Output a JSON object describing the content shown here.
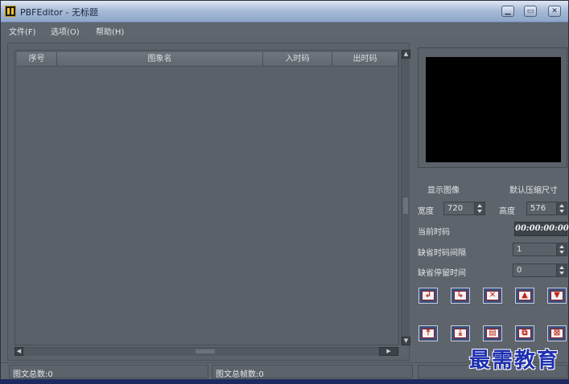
{
  "window": {
    "title": "PBFEditor - 无标题"
  },
  "menu": [
    "文件(F)",
    "选项(O)",
    "帮助(H)"
  ],
  "list": {
    "columns": [
      "序号",
      "图象名",
      "入时码",
      "出时码"
    ]
  },
  "preview": {
    "display_label": "显示图像",
    "compress_label": "默认压缩尺寸"
  },
  "size": {
    "width_label": "宽度",
    "width_value": "720",
    "height_label": "高度",
    "height_value": "576"
  },
  "timecode": {
    "current_label": "当前时码",
    "current_value": "00:00:00:00",
    "interval_label": "缺省时码间隔",
    "interval_value": "1",
    "dwell_label": "缺省停留时间",
    "dwell_value": "0"
  },
  "tools_row1": [
    {
      "name": "insert-icon",
      "glyph": "↲"
    },
    {
      "name": "append-icon",
      "glyph": "↳"
    },
    {
      "name": "delete-icon",
      "glyph": "✕"
    },
    {
      "name": "move-up-icon",
      "glyph": "▲"
    },
    {
      "name": "move-down-icon",
      "glyph": "▼"
    }
  ],
  "tools_row2": [
    {
      "name": "move-top-icon",
      "glyph": "⤒"
    },
    {
      "name": "move-bottom-icon",
      "glyph": "⤓"
    },
    {
      "name": "film-icon",
      "glyph": "▤"
    },
    {
      "name": "copy-icon",
      "glyph": "⧉"
    },
    {
      "name": "clear-all-icon",
      "glyph": "⊠"
    }
  ],
  "status": {
    "total_label": "图文总数:0",
    "frames_label": "图文总帧数:0"
  },
  "watermark": "最需教育"
}
